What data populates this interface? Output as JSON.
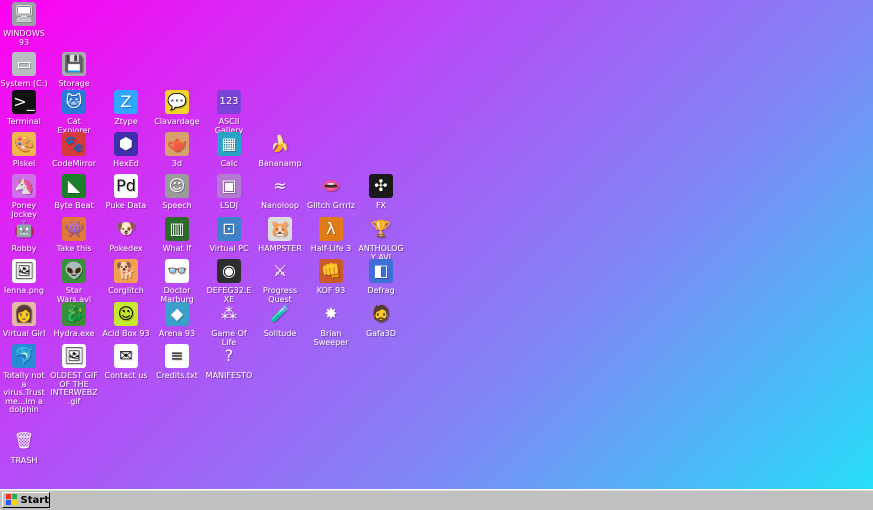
{
  "desktop": {
    "icons": [
      {
        "label": "WINDOWS 93",
        "name": "windows-93-icon",
        "glyph": "🖥",
        "bg": "#9aa0a6"
      },
      {
        "label": "System (C:)",
        "name": "system-drive-icon",
        "glyph": "▭",
        "bg": "#b9bcc0"
      },
      {
        "label": "Storage (A:)",
        "name": "storage-drive-icon",
        "glyph": "💾",
        "bg": "#a8abb0"
      },
      {
        "label": "Terminal",
        "name": "terminal-icon",
        "glyph": ">_",
        "bg": "#111111"
      },
      {
        "label": "Cat Explorer",
        "name": "cat-explorer-icon",
        "glyph": "🐱",
        "bg": "#2b7ad8"
      },
      {
        "label": "Ztype",
        "name": "ztype-icon",
        "glyph": "Z",
        "bg": "#31a6ff"
      },
      {
        "label": "Clavardage",
        "name": "clavardage-icon",
        "glyph": "💬",
        "bg": "#f3d22b"
      },
      {
        "label": "ASCII Gallery",
        "name": "ascii-gallery-icon",
        "glyph": "123",
        "bg": "#7a44d9"
      },
      {
        "label": "Piskel",
        "name": "piskel-icon",
        "glyph": "🎨",
        "bg": "#f0b84d"
      },
      {
        "label": "CodeMirror",
        "name": "codemirror-icon",
        "glyph": "🐾",
        "bg": "#d43b3b"
      },
      {
        "label": "HexEd",
        "name": "hexed-icon",
        "glyph": "⬢",
        "bg": "#3f2fa9"
      },
      {
        "label": "3d",
        "name": "3d-icon",
        "glyph": "🫖",
        "bg": "#d8a06b"
      },
      {
        "label": "Calc",
        "name": "calc-icon",
        "glyph": "▦",
        "bg": "#2aa3c9"
      },
      {
        "label": "Bananamp",
        "name": "bananamp-icon",
        "glyph": "🍌",
        "bg": "transparent"
      },
      {
        "label": "Poney Jockey",
        "name": "poney-jockey-icon",
        "glyph": "🦄",
        "bg": "#d06fe8"
      },
      {
        "label": "Byte Beat",
        "name": "byte-beat-icon",
        "glyph": "◣",
        "bg": "#1b7f2a"
      },
      {
        "label": "Puke Data",
        "name": "puke-data-icon",
        "glyph": "Pd",
        "bg": "#ffffff"
      },
      {
        "label": "Speech",
        "name": "speech-icon",
        "glyph": "☺",
        "bg": "#9a9a9a"
      },
      {
        "label": "LSDJ",
        "name": "lsdj-icon",
        "glyph": "▣",
        "bg": "#b37ad2"
      },
      {
        "label": "Nanoloop",
        "name": "nanoloop-icon",
        "glyph": "≈",
        "bg": "transparent"
      },
      {
        "label": "Glitch Grrrlz",
        "name": "glitch-grrrlz-icon",
        "glyph": "👄",
        "bg": "transparent"
      },
      {
        "label": "FX",
        "name": "fx-icon",
        "glyph": "✣",
        "bg": "#1a1a1a"
      },
      {
        "label": "Robby",
        "name": "robby-icon",
        "glyph": "🤖",
        "bg": "transparent"
      },
      {
        "label": "Take this",
        "name": "take-this-icon",
        "glyph": "👾",
        "bg": "#e07a3a"
      },
      {
        "label": "Pokedex",
        "name": "pokedex-icon",
        "glyph": "🐶",
        "bg": "transparent"
      },
      {
        "label": "What If",
        "name": "what-if-icon",
        "glyph": "▥",
        "bg": "#2d6b2d"
      },
      {
        "label": "Virtual PC",
        "name": "virtual-pc-icon",
        "glyph": "⊡",
        "bg": "#3e83c9"
      },
      {
        "label": "HAMPSTER",
        "name": "hampster-icon",
        "glyph": "🐹",
        "bg": "#dcdcdc"
      },
      {
        "label": "Half-Life 3",
        "name": "half-life-3-icon",
        "glyph": "λ",
        "bg": "#e07b17"
      },
      {
        "label": "ANTHOLOGY AVI",
        "name": "anthology-avi-icon",
        "glyph": "🏆",
        "bg": "transparent"
      },
      {
        "label": "lenna.png",
        "name": "lenna-png-icon",
        "glyph": "🖼",
        "bg": "#ffffff"
      },
      {
        "label": "Star Wars.avi",
        "name": "star-wars-avi-icon",
        "glyph": "👽",
        "bg": "#3b8f3b"
      },
      {
        "label": "Corglitch",
        "name": "corglitch-icon",
        "glyph": "🐕",
        "bg": "#f1a150"
      },
      {
        "label": "Doctor Marburg",
        "name": "doctor-marburg-icon",
        "glyph": "👓",
        "bg": "#ffffff"
      },
      {
        "label": "DEFEG32.EXE",
        "name": "defeg32-exe-icon",
        "glyph": "◉",
        "bg": "#2d2d2d"
      },
      {
        "label": "Progress Quest",
        "name": "progress-quest-icon",
        "glyph": "⚔",
        "bg": "transparent"
      },
      {
        "label": "KOF 93",
        "name": "kof-93-icon",
        "glyph": "👊",
        "bg": "#c85a2b"
      },
      {
        "label": "Defrag",
        "name": "defrag-icon",
        "glyph": "◧",
        "bg": "#3c6fd8"
      },
      {
        "label": "Virtual Girl",
        "name": "virtual-girl-icon",
        "glyph": "👩",
        "bg": "#e7b8a7"
      },
      {
        "label": "Hydra.exe",
        "name": "hydra-exe-icon",
        "glyph": "🐉",
        "bg": "#3a8f3a"
      },
      {
        "label": "Acid Box 93",
        "name": "acid-box-93-icon",
        "glyph": "☺",
        "bg": "#c6e82d"
      },
      {
        "label": "Arena 93",
        "name": "arena-93-icon",
        "glyph": "◆",
        "bg": "#3aa0c9"
      },
      {
        "label": "Game Of Life",
        "name": "game-of-life-icon",
        "glyph": "⁂",
        "bg": "transparent"
      },
      {
        "label": "Solitude",
        "name": "solitude-icon",
        "glyph": "🧪",
        "bg": "transparent"
      },
      {
        "label": "Brian Sweeper",
        "name": "brian-sweeper-icon",
        "glyph": "✸",
        "bg": "transparent"
      },
      {
        "label": "Gafa3D",
        "name": "gafa3d-icon",
        "glyph": "🧔",
        "bg": "transparent"
      },
      {
        "label": "Totally not a virus.Trust me...im a dolphin",
        "name": "dolphin-icon",
        "glyph": "🐬",
        "bg": "#2b8ad8"
      },
      {
        "label": "OLDEST GIF OF THE INTERWEBZ.gif",
        "name": "oldest-gif-icon",
        "glyph": "🖼",
        "bg": "#ffffff"
      },
      {
        "label": "Contact us",
        "name": "contact-us-icon",
        "glyph": "✉",
        "bg": "#ffffff"
      },
      {
        "label": "Credits.txt",
        "name": "credits-txt-icon",
        "glyph": "≡",
        "bg": "#ffffff"
      },
      {
        "label": "MANIFESTO",
        "name": "manifesto-icon",
        "glyph": "?",
        "bg": "transparent"
      },
      {
        "label": "TRASH",
        "name": "trash-icon",
        "glyph": "🗑",
        "bg": "transparent"
      }
    ]
  },
  "taskbar": {
    "start_label": "Start"
  }
}
